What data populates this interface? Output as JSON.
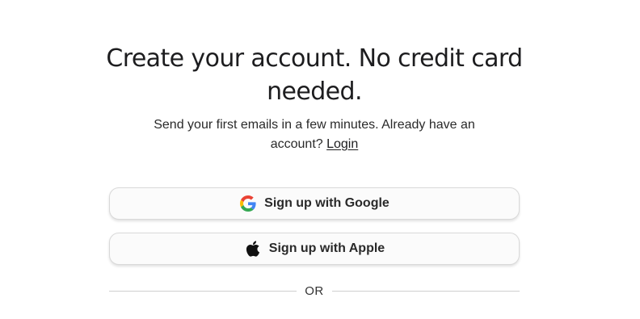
{
  "header": {
    "title": "Create your account. No credit card needed.",
    "subtitle_prefix": "Send your first emails in a few minutes. Already have an account?",
    "login_link": "Login"
  },
  "auth": {
    "google_label": "Sign up with Google",
    "apple_label": "Sign up with Apple",
    "google_icon": "google-icon",
    "apple_icon": "apple-icon"
  },
  "divider": {
    "label": "OR"
  },
  "colors": {
    "google_blue": "#4285F4",
    "google_red": "#EA4335",
    "google_yellow": "#FBBC05",
    "google_green": "#34A853",
    "apple_black": "#111111"
  }
}
